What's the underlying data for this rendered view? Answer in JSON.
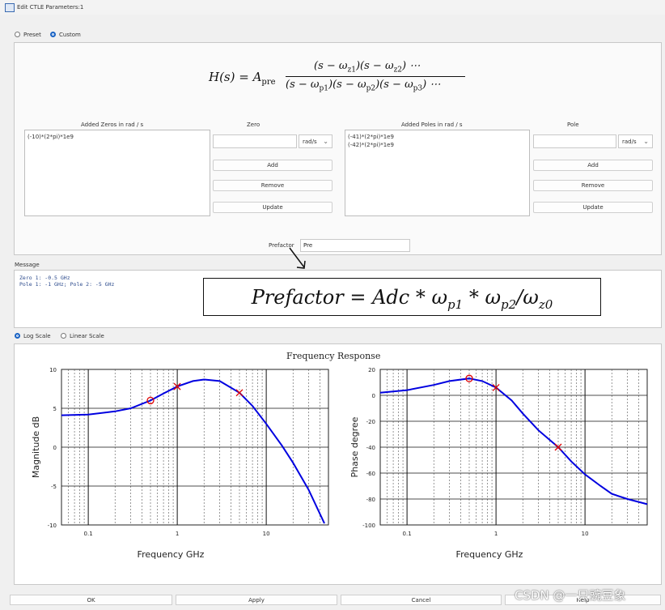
{
  "window": {
    "title": "Edit CTLE Parameters:1"
  },
  "mode": {
    "options": [
      "Preset",
      "Custom"
    ],
    "selected": "Custom"
  },
  "formula": {
    "lhs": "H(s) = A",
    "pre_sub": "pre",
    "numerator": "(s − ω",
    "denominator": "(s − ω"
  },
  "zeros": {
    "header": "Added Zeros in rad / s",
    "items": [
      "(-10)*(2*pi)*1e9"
    ],
    "input_label": "Zero",
    "input_value": "",
    "unit": "rad/s",
    "add_label": "Add",
    "remove_label": "Remove",
    "update_label": "Update"
  },
  "poles": {
    "header": "Added Poles in rad / s",
    "items": [
      "(-41)*(2*pi)*1e9",
      "(-42)*(2*pi)*1e9"
    ],
    "input_label": "Pole",
    "input_value": "",
    "unit": "rad/s",
    "add_label": "Add",
    "remove_label": "Remove",
    "update_label": "Update"
  },
  "prefactor": {
    "label": "Prefactor",
    "value": "Pre"
  },
  "message": {
    "label": "Message",
    "line1": "Zero 1: -0.5 GHz",
    "line2": "Pole 1: -1 GHz;   Pole 2: -5 GHz"
  },
  "annotation": {
    "text": "Prefactor = Adc * ω"
  },
  "scale": {
    "options": [
      "Log Scale",
      "Linear Scale"
    ],
    "selected": "Log Scale"
  },
  "plot_title": "Frequency Response",
  "chart_data": [
    {
      "type": "line",
      "title": "Frequency Response",
      "xlabel": "Frequency    GHz",
      "ylabel": "Magnitude    dB",
      "xscale": "log",
      "xlim": [
        0.05,
        50
      ],
      "ylim": [
        -10,
        10
      ],
      "xticks": [
        "0.1",
        "1",
        "10"
      ],
      "yticks": [
        "10",
        "5",
        "0",
        "-5",
        "-10"
      ],
      "grid": true,
      "series": [
        {
          "color": "#0000e0",
          "x": [
            0.05,
            0.1,
            0.2,
            0.3,
            0.5,
            0.7,
            1,
            1.5,
            2,
            3,
            5,
            7,
            10,
            15,
            20,
            30,
            45
          ],
          "y": [
            4.1,
            4.2,
            4.6,
            5.0,
            6.0,
            6.9,
            7.8,
            8.5,
            8.7,
            8.5,
            7.0,
            5.3,
            3.0,
            0.2,
            -2.0,
            -5.5,
            -9.8
          ]
        }
      ],
      "markers": [
        {
          "kind": "zero",
          "x": 0.5,
          "y": 6.0
        },
        {
          "kind": "pole",
          "x": 1,
          "y": 7.8
        },
        {
          "kind": "pole",
          "x": 5,
          "y": 7.0
        }
      ]
    },
    {
      "type": "line",
      "xlabel": "Frequency    GHz",
      "ylabel": "Phase    degree",
      "xscale": "log",
      "xlim": [
        0.05,
        50
      ],
      "ylim": [
        -100,
        20
      ],
      "xticks": [
        "0.1",
        "1",
        "10"
      ],
      "yticks": [
        "20",
        "0",
        "-20",
        "-40",
        "-60",
        "-80",
        "-100"
      ],
      "grid": true,
      "series": [
        {
          "color": "#0000e0",
          "x": [
            0.05,
            0.1,
            0.2,
            0.3,
            0.5,
            0.7,
            1,
            1.5,
            2,
            3,
            5,
            7,
            10,
            15,
            20,
            30,
            50
          ],
          "y": [
            2,
            4,
            8,
            11,
            13,
            11,
            6,
            -4,
            -14,
            -27,
            -40,
            -51,
            -61,
            -70,
            -76,
            -80,
            -84
          ]
        }
      ],
      "markers": [
        {
          "kind": "zero",
          "x": 0.5,
          "y": 13
        },
        {
          "kind": "pole",
          "x": 1,
          "y": 6
        },
        {
          "kind": "pole",
          "x": 5,
          "y": -40
        }
      ]
    }
  ],
  "buttons": {
    "ok": "OK",
    "apply": "Apply",
    "cancel": "Cancel",
    "help": "Help"
  },
  "watermark": "CSDN @一只豌豆象"
}
